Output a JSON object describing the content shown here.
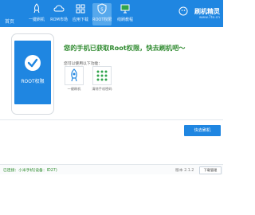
{
  "window": {
    "brand_small": "首页"
  },
  "nav": {
    "items": [
      {
        "label": "一键刷机"
      },
      {
        "label": "ROM市场"
      },
      {
        "label": "应用下载"
      },
      {
        "label": "ROOT权限"
      },
      {
        "label": "线刷教程"
      }
    ],
    "active_index": 3
  },
  "logo": {
    "name": "刷机精灵",
    "url": "www.7to.cn"
  },
  "phone": {
    "label": "ROOT权限"
  },
  "main": {
    "headline": "您的手机已获取Root权限，快去刷机吧～",
    "subtitle": "您可以使用以下功能：",
    "options": [
      {
        "label": "一键刷机"
      },
      {
        "label": "清除手机密码"
      }
    ],
    "action_label": "快去刷机"
  },
  "status": {
    "text": "已连接：小米手机(设备：ID27)",
    "version": "版本 2.1.2",
    "download_label": "下载管理"
  },
  "colors": {
    "primary": "#1f86e1",
    "success": "#2f8a2f"
  }
}
